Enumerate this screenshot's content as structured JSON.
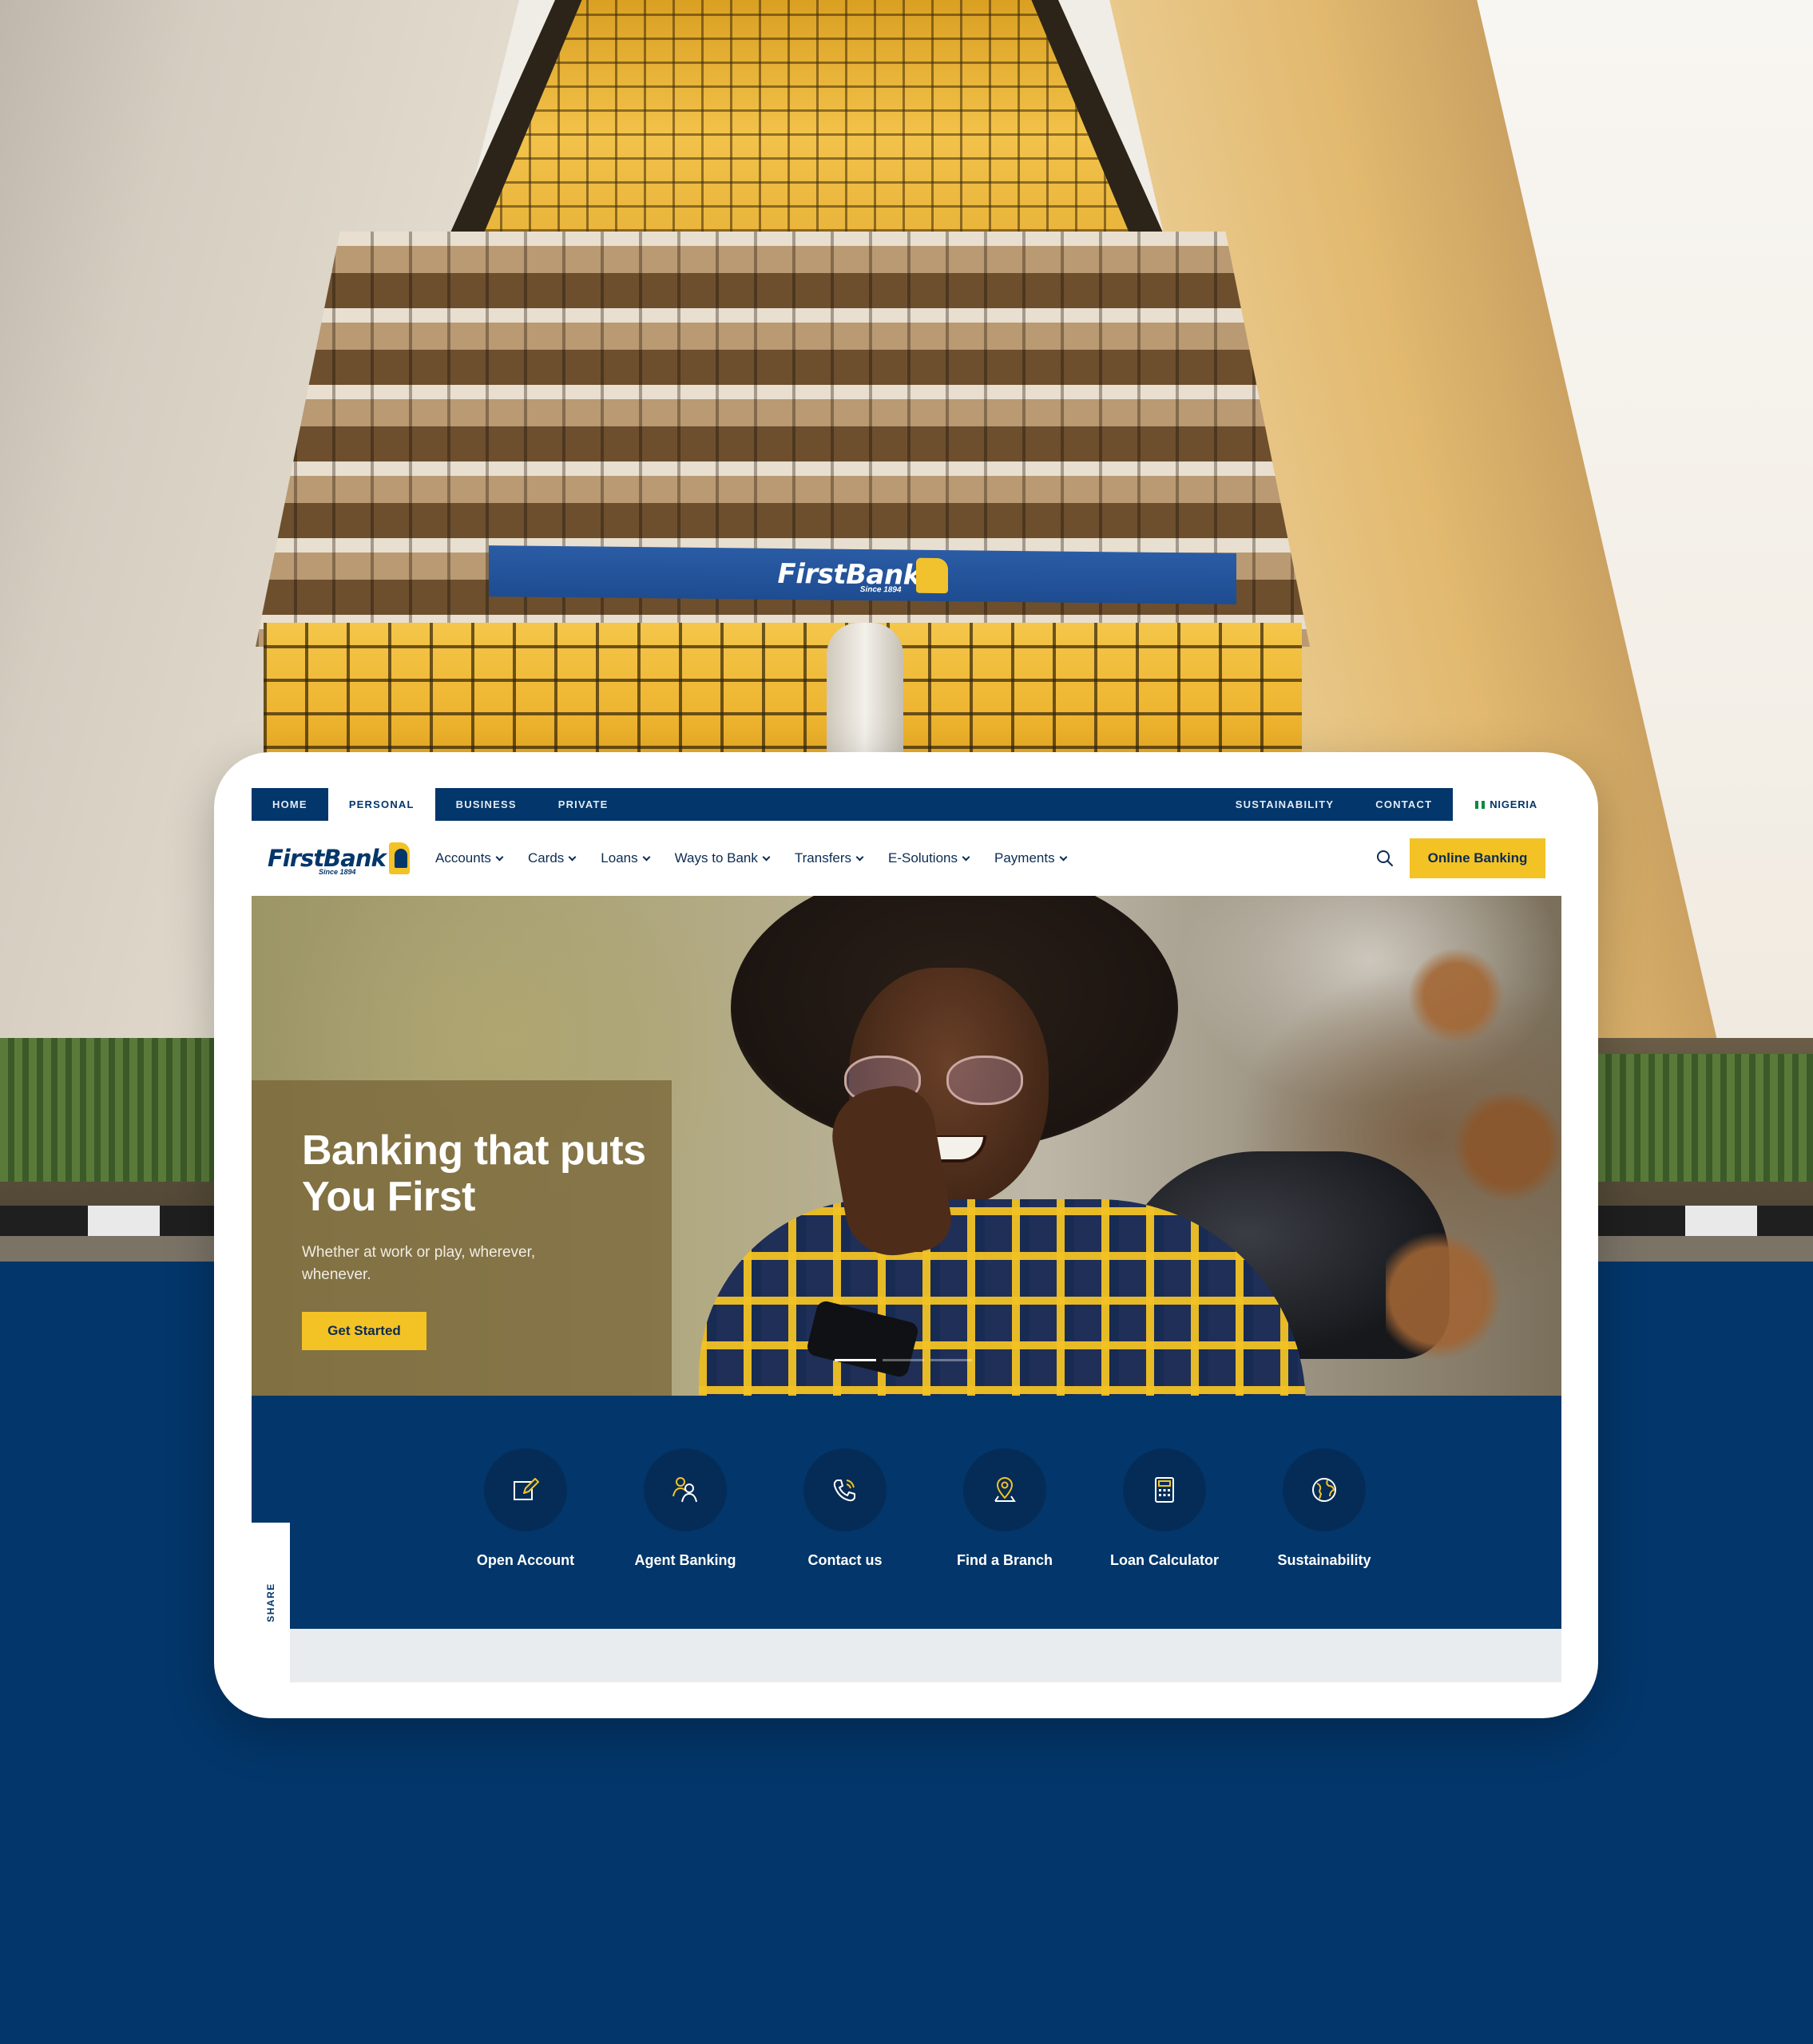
{
  "background_sign": {
    "brand": "FirstBank",
    "tagline": "Since 1894"
  },
  "top_bar": {
    "tabs": [
      "HOME",
      "PERSONAL",
      "BUSINESS",
      "PRIVATE"
    ],
    "active_tab": "PERSONAL",
    "right_links": [
      "SUSTAINABILITY",
      "CONTACT"
    ],
    "country": "NIGERIA"
  },
  "logo": {
    "name": "FirstBank",
    "tagline": "Since 1894"
  },
  "main_nav": {
    "items": [
      "Accounts",
      "Cards",
      "Loans",
      "Ways to Bank",
      "Transfers",
      "E-Solutions",
      "Payments"
    ],
    "search_icon": "search-icon",
    "cta": "Online Banking"
  },
  "hero": {
    "title": "Banking that puts You First",
    "subtitle": "Whether at work or play, wherever, whenever.",
    "button": "Get Started",
    "slide_count": 3,
    "active_slide": 1
  },
  "quick_links": [
    {
      "label": "Open Account",
      "icon": "edit-icon"
    },
    {
      "label": "Agent Banking",
      "icon": "users-icon"
    },
    {
      "label": "Contact us",
      "icon": "phone-icon"
    },
    {
      "label": "Find a Branch",
      "icon": "location-pin-icon"
    },
    {
      "label": "Loan Calculator",
      "icon": "calculator-icon"
    },
    {
      "label": "Sustainability",
      "icon": "globe-icon"
    }
  ],
  "share": {
    "label": "SHARE"
  },
  "colors": {
    "navy": "#03366a",
    "gold": "#f3c225",
    "white": "#ffffff"
  }
}
